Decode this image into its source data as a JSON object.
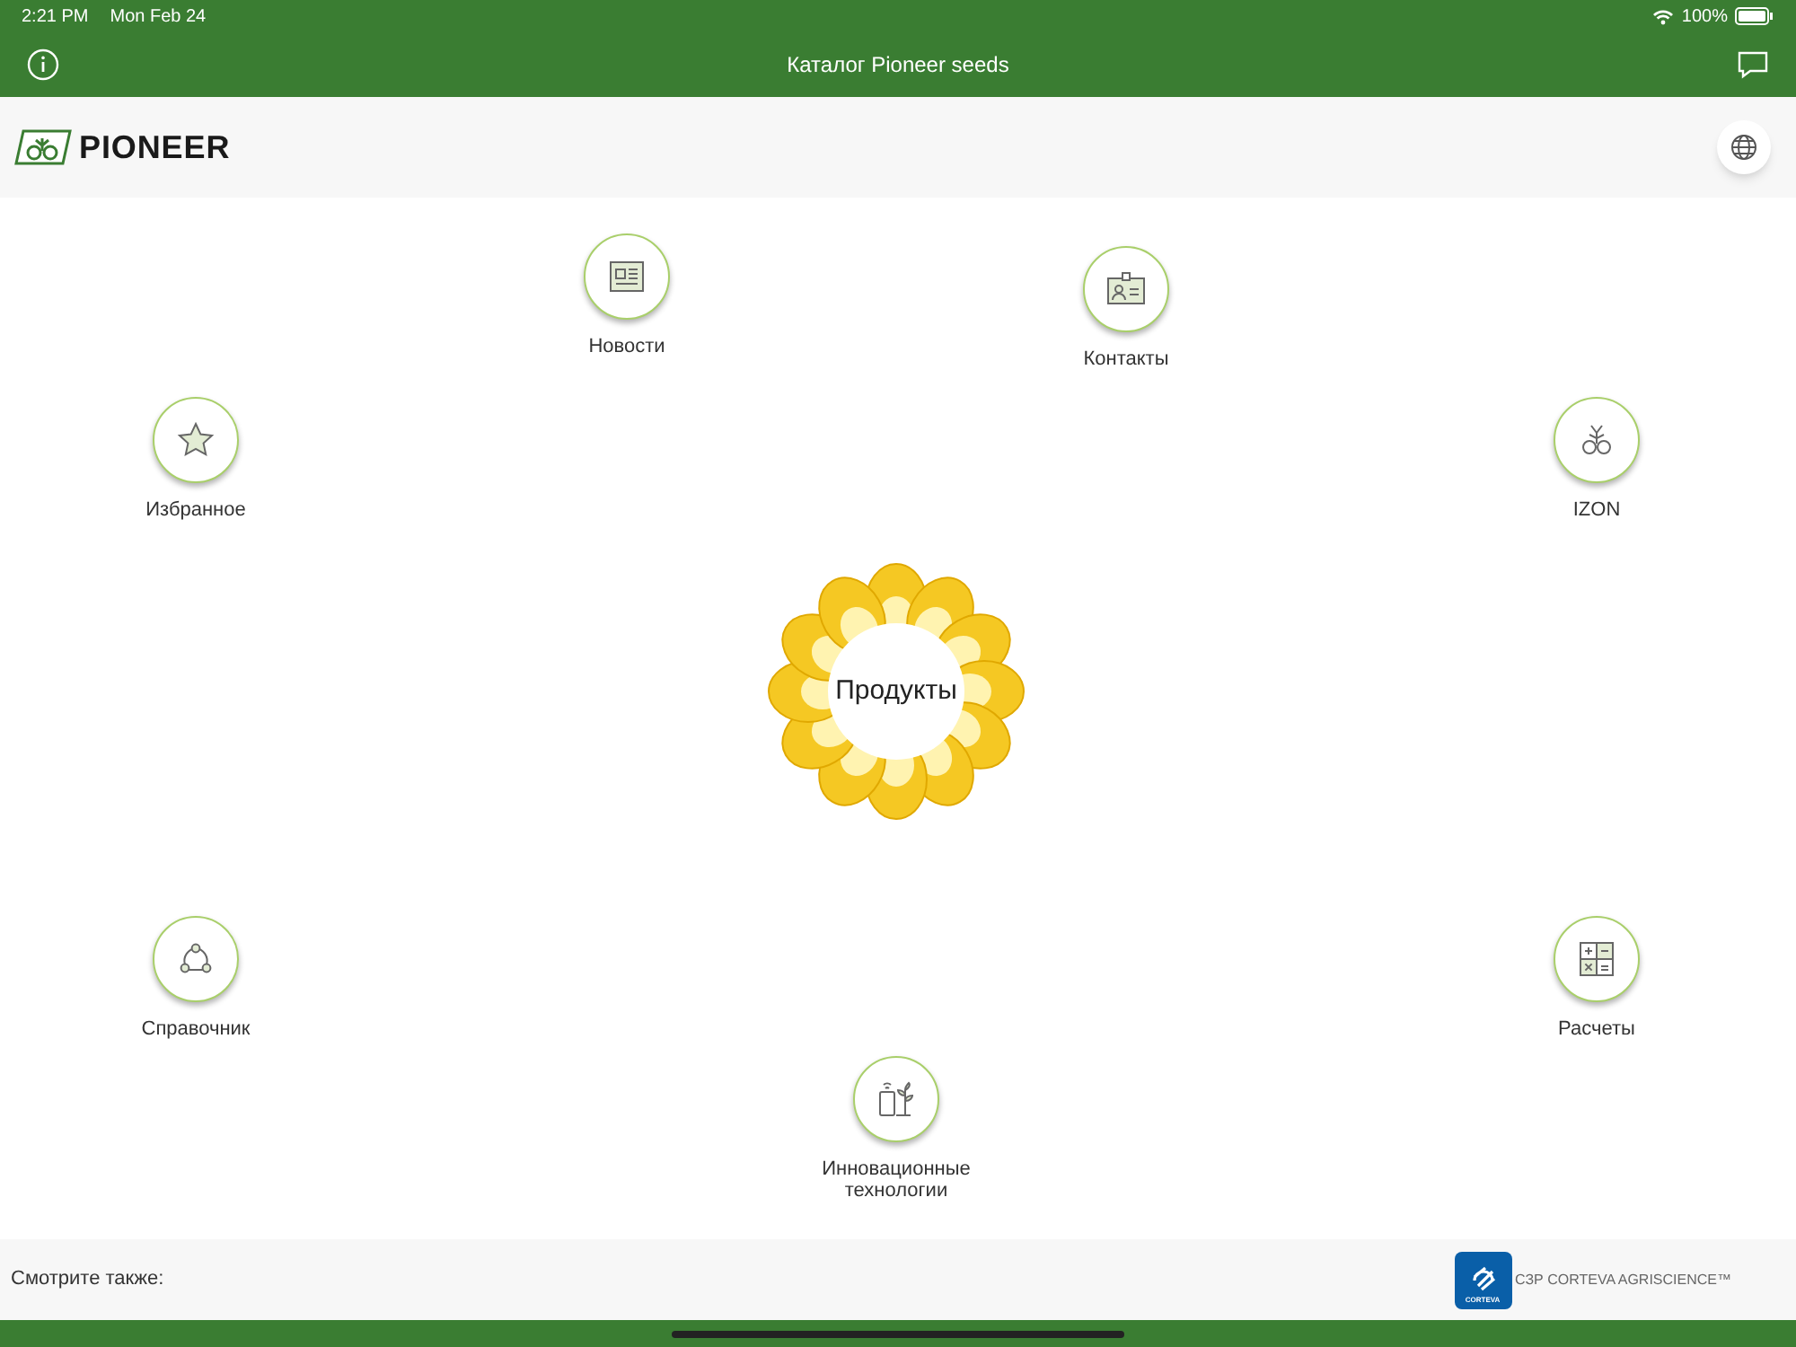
{
  "status_bar": {
    "time": "2:21 PM",
    "date": "Mon Feb 24",
    "battery": "100%"
  },
  "nav_bar": {
    "title": "Каталог Pioneer seeds"
  },
  "header": {
    "logo_text": "PIONEER"
  },
  "center_button": {
    "label": "Продукты"
  },
  "menu_items": [
    {
      "label": "Новости"
    },
    {
      "label": "Контакты"
    },
    {
      "label": "Избранное"
    },
    {
      "label": "IZON"
    },
    {
      "label": "Справочник"
    },
    {
      "label": "Расчеты"
    },
    {
      "label": "Инновационные технологии"
    }
  ],
  "footer": {
    "see_also": "Смотрите также:",
    "partner_logo_text": "CORTEVA",
    "partner": "СЗР CORTEVA AGRISCIENCE™"
  }
}
